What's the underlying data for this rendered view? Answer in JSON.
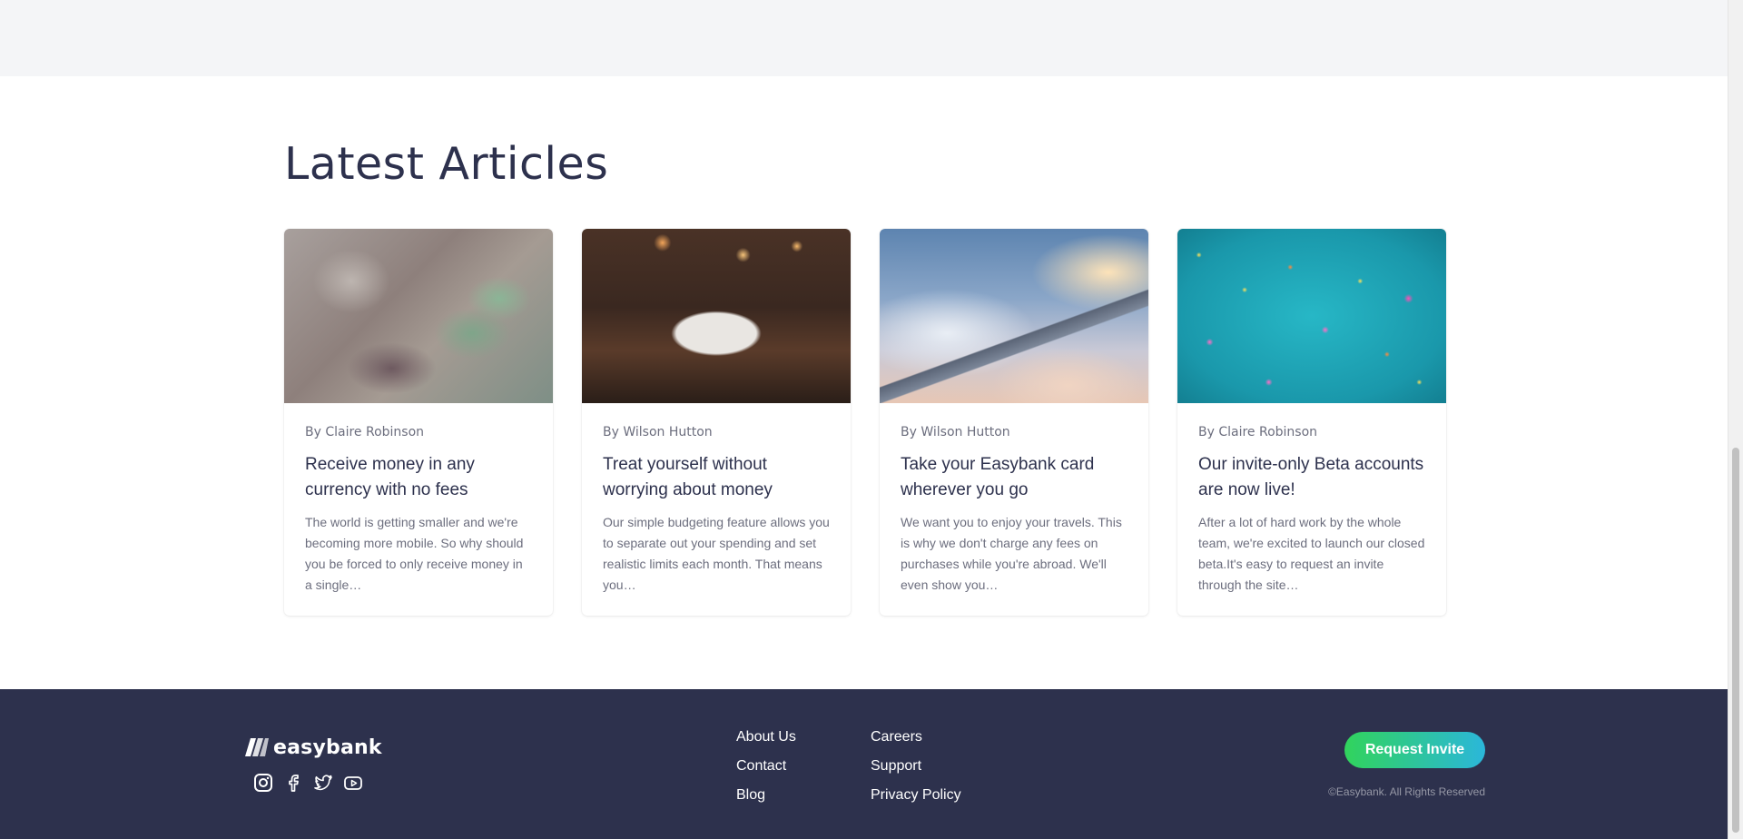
{
  "section": {
    "title": "Latest Articles"
  },
  "articles": [
    {
      "image": "money-banknotes-photo",
      "author": "By Claire Robinson",
      "title": "Receive money in any currency with no fees",
      "excerpt": "The world is getting smaller and we're becoming more mobile. So why should you be forced to only receive money in a single…"
    },
    {
      "image": "restaurant-dining-photo",
      "author": "By Wilson Hutton",
      "title": "Treat yourself without worrying about money",
      "excerpt": "Our simple budgeting feature allows you to separate out your spending and set realistic limits each month. That means you…"
    },
    {
      "image": "airplane-wing-photo",
      "author": "By Wilson Hutton",
      "title": "Take your Easybank card wherever you go",
      "excerpt": "We want you to enjoy your travels. This is why we don't charge any fees on purchases while you're abroad. We'll even show you…"
    },
    {
      "image": "confetti-photo",
      "author": "By Claire Robinson",
      "title": "Our invite-only Beta accounts are now live!",
      "excerpt": "After a lot of hard work by the whole team, we're excited to launch our closed beta.It's easy to request an invite through the site…"
    }
  ],
  "footer": {
    "logo_text": "easybank",
    "socials": [
      "instagram-icon",
      "facebook-icon",
      "twitter-icon",
      "youtube-icon"
    ],
    "links": [
      "About Us",
      "Careers",
      "Contact",
      "Support",
      "Blog",
      "Privacy Policy"
    ],
    "cta_label": "Request Invite",
    "copyright": "©Easybank. All Rights Reserved"
  },
  "colors": {
    "dark_blue": "#2d314d",
    "grayish_blue": "#6c6e7e",
    "light_gray": "#f4f5f7",
    "lime_green": "#31d35c",
    "bright_cyan": "#2bb7da"
  }
}
